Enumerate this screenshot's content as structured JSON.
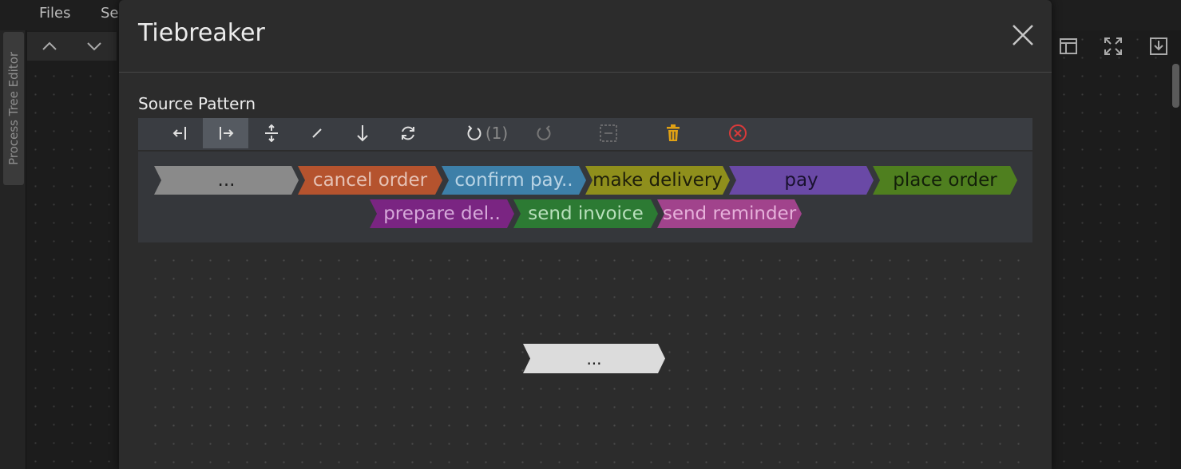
{
  "app": {
    "menu": [
      "Files",
      "Se"
    ],
    "sidebar_tab": "Process Tree Editor"
  },
  "modal": {
    "title": "Tiebreaker",
    "section_label": "Source Pattern",
    "toolbar": {
      "active_button": "insert-right",
      "buttons": [
        "insert-left-icon",
        "insert-right-icon",
        "expand-icon",
        "edit-icon",
        "down-icon",
        "refresh-icon",
        "undo-icon",
        "redo-icon",
        "collapse-icon",
        "delete-icon",
        "remove-circle-icon"
      ],
      "undo_count": "(1)"
    },
    "activities": [
      {
        "label": "...",
        "color": "#8a8a8a",
        "text_color": "#1a1a1a"
      },
      {
        "label": "cancel order",
        "color": "#b5532e",
        "text_color": "#e6c2b5"
      },
      {
        "label": "confirm pay..",
        "color": "#3d7fa8",
        "text_color": "#b9d4e5"
      },
      {
        "label": "make delivery",
        "color": "#8f8f1c",
        "text_color": "#1f1f0a"
      },
      {
        "label": "pay",
        "color": "#6a49a6",
        "text_color": "#1a1230"
      },
      {
        "label": "place order",
        "color": "#4f7f1f",
        "text_color": "#13200a"
      },
      {
        "label": "prepare del..",
        "color": "#7a2582",
        "text_color": "#d6a9da"
      },
      {
        "label": "send invoice",
        "color": "#2c7a33",
        "text_color": "#b9e0bc"
      },
      {
        "label": "send reminder",
        "color": "#a1438c",
        "text_color": "#e6b0da"
      }
    ],
    "root_node": {
      "label": "..."
    }
  },
  "colors": {
    "delete": "#e0a114",
    "remove": "#d93a3a",
    "modal_bg": "#2c2c2c"
  }
}
